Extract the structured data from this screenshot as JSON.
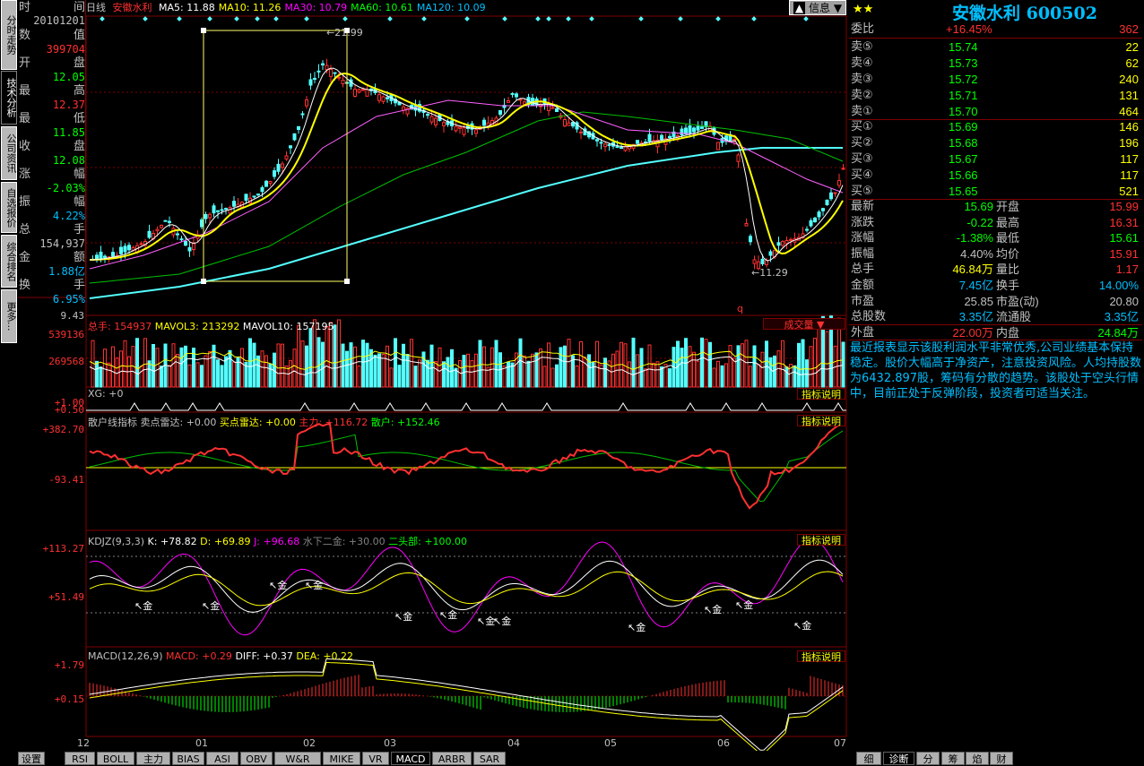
{
  "left_nav": {
    "tabs": [
      "分时走势",
      "技术分析",
      "公司资讯",
      "自选报价",
      "综合排名",
      "更多..."
    ],
    "active": 1
  },
  "info_panel": {
    "date_label": "时",
    "date_label2": "间",
    "date": "20101201",
    "rows": [
      {
        "l": "数",
        "r": "值",
        "val": "399704",
        "color": "#ff3030"
      },
      {
        "l": "开",
        "r": "盘",
        "val": "12.05",
        "color": "#00ff00"
      },
      {
        "l": "最",
        "r": "高",
        "val": "12.37",
        "color": "#ff3030"
      },
      {
        "l": "最",
        "r": "低",
        "val": "11.85",
        "color": "#00ff00"
      },
      {
        "l": "收",
        "r": "盘",
        "val": "12.08",
        "color": "#00ff00"
      },
      {
        "l": "涨",
        "r": "幅",
        "val": "-2.03%",
        "color": "#00ff00"
      },
      {
        "l": "振",
        "r": "幅",
        "val": "4.22%",
        "color": "#00bfff"
      },
      {
        "l": "总",
        "r": "手",
        "val": "154,937",
        "color": "#c0c0c0"
      },
      {
        "l": "金",
        "r": "额",
        "val": "1.88亿",
        "color": "#00bfff"
      },
      {
        "l": "换",
        "r": "手",
        "val": "6.95%",
        "color": "#00bfff"
      }
    ],
    "bottom_val": "9.43"
  },
  "header": {
    "period": "日线",
    "name": "安徽水利",
    "ma": [
      {
        "label": "MA5: 11.88",
        "color": "#ffffff"
      },
      {
        "label": "MA10: 11.26",
        "color": "#ffff00"
      },
      {
        "label": "MA30: 10.79",
        "color": "#ff00ff"
      },
      {
        "label": "MA60: 10.61",
        "color": "#00ff00"
      },
      {
        "label": "MA120: 10.09",
        "color": "#00bfff"
      }
    ],
    "info_button": "信息"
  },
  "main_chart": {
    "high_label": "21.99",
    "low_label": "11.29",
    "q_mark": "q"
  },
  "volume": {
    "title": "总手: 154937",
    "mavol3": "MAVOL3: 213292",
    "mavol10": "MAVOL10: 157195",
    "axis_top": "539136",
    "axis_mid": "269568",
    "button": "成交量"
  },
  "xg": {
    "title": "XG: +0",
    "axis_top": "+1.00",
    "axis_bot": "+0.50",
    "button": "指标说明"
  },
  "sanhu": {
    "title": "散户线指标",
    "sell": "卖点雷达: +0.00",
    "buy": "买点雷达: +0.00",
    "main": "主力: +116.72",
    "retail": "散户: +152.46",
    "axis_top": "+382.70",
    "axis_mid": "-93.41",
    "button": "指标说明"
  },
  "kdj": {
    "title": "KDJZ(9,3,3)",
    "k": "K: +78.82",
    "d": "D: +69.89",
    "j": "J: +96.68",
    "water": "水下二金: +30.00",
    "two": "二头部: +100.00",
    "axis_top": "+113.27",
    "axis_mid": "+51.49",
    "button": "指标说明",
    "gold": "金"
  },
  "macd": {
    "title": "MACD(12,26,9)",
    "macd": "MACD: +0.29",
    "diff": "DIFF: +0.37",
    "dea": "DEA: +0.22",
    "axis_top": "+1.79",
    "axis_mid": "+0.15",
    "button": "指标说明"
  },
  "x_axis": [
    "12",
    "01",
    "02",
    "03",
    "04",
    "05",
    "06",
    "07"
  ],
  "right_panel": {
    "title": "安徽水利 600502",
    "stars": "★★",
    "weibi": {
      "label": "委比",
      "val": "+16.45%",
      "num": "362"
    },
    "sell": [
      {
        "label": "卖⑤",
        "price": "15.74",
        "vol": "22"
      },
      {
        "label": "卖④",
        "price": "15.73",
        "vol": "62"
      },
      {
        "label": "卖③",
        "price": "15.72",
        "vol": "240"
      },
      {
        "label": "卖②",
        "price": "15.71",
        "vol": "131"
      },
      {
        "label": "卖①",
        "price": "15.70",
        "vol": "464"
      }
    ],
    "buy": [
      {
        "label": "买①",
        "price": "15.69",
        "vol": "146"
      },
      {
        "label": "买②",
        "price": "15.68",
        "vol": "196"
      },
      {
        "label": "买③",
        "price": "15.67",
        "vol": "117"
      },
      {
        "label": "买④",
        "price": "15.66",
        "vol": "117"
      },
      {
        "label": "买⑤",
        "price": "15.65",
        "vol": "521"
      }
    ],
    "stats": [
      {
        "l1": "最新",
        "v1": "15.69",
        "c1": "#00ff00",
        "l2": "开盘",
        "v2": "15.99",
        "c2": "#ff3030"
      },
      {
        "l1": "涨跌",
        "v1": "-0.22",
        "c1": "#00ff00",
        "l2": "最高",
        "v2": "16.31",
        "c2": "#ff3030"
      },
      {
        "l1": "涨幅",
        "v1": "-1.38%",
        "c1": "#00ff00",
        "l2": "最低",
        "v2": "15.61",
        "c2": "#00ff00"
      },
      {
        "l1": "振幅",
        "v1": "4.40%",
        "c1": "#c0c0c0",
        "l2": "均价",
        "v2": "15.91",
        "c2": "#ff3030"
      },
      {
        "l1": "总手",
        "v1": "46.84万",
        "c1": "#ffff00",
        "l2": "量比",
        "v2": "1.17",
        "c2": "#ff3030"
      },
      {
        "l1": "金额",
        "v1": "7.45亿",
        "c1": "#00bfff",
        "l2": "换手",
        "v2": "14.00%",
        "c2": "#00bfff"
      },
      {
        "l1": "市盈",
        "v1": "25.85",
        "c1": "#c0c0c0",
        "l2": "市盈(动)",
        "v2": "20.80",
        "c2": "#c0c0c0"
      },
      {
        "l1": "总股数",
        "v1": "3.35亿",
        "c1": "#00bfff",
        "l2": "流通股",
        "v2": "3.35亿",
        "c2": "#00bfff"
      },
      {
        "l1": "外盘",
        "v1": "22.00万",
        "c1": "#ff3030",
        "l2": "内盘",
        "v2": "24.84万",
        "c2": "#00ff00"
      }
    ],
    "description": "最近报表显示该股利润水平非常优秀,公司业绩基本保持稳定。股价大幅高于净资产，注意投资风险。人均持股数为6432.897股，筹码有分散的趋势。该股处于空头行情中，目前正处于反弹阶段，投资者可适当关注。"
  },
  "bottom_tabs": [
    "设置",
    "RSI",
    "BOLL",
    "主力",
    "BIAS",
    "ASI",
    "OBV",
    "W&R",
    "MIKE",
    "VR",
    "MACD",
    "ARBR",
    "SAR"
  ],
  "bottom_active": 10,
  "right_tabs": [
    "细",
    "诊断",
    "分",
    "筹",
    "焰",
    "财"
  ],
  "right_active": 1
}
